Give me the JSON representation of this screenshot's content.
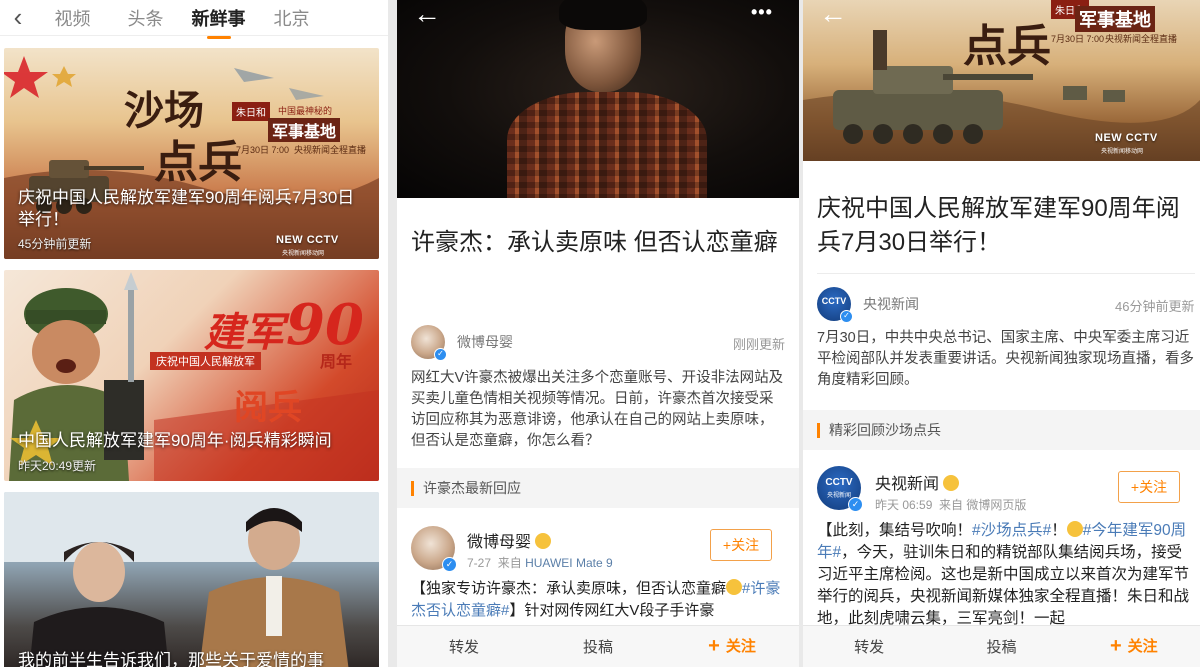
{
  "panel1": {
    "nav": {
      "back_icon": "chevron-left-icon",
      "tabs": [
        {
          "label": "视频",
          "active": false
        },
        {
          "label": "头条",
          "active": false
        },
        {
          "label": "新鲜事",
          "active": true
        },
        {
          "label": "北京",
          "active": false
        }
      ],
      "active_color": "#ff8200"
    },
    "cards": [
      {
        "title": "庆祝中国人民解放军建军90周年阅兵7月30日举行！",
        "time": "45分钟前更新",
        "poster_big_text_1": "沙场",
        "poster_big_text_2": "点兵",
        "poster_person": "朱日和",
        "poster_tag": "中国最神秘的",
        "poster_headline": "军事基地",
        "poster_date": "7月30日 7:00",
        "poster_channel": "央视新闻全程直播",
        "logo": "NEW CCTV",
        "logo_sub": "央视新闻移动网"
      },
      {
        "title": "中国人民解放军建军90周年·阅兵精彩瞬间",
        "time": "昨天20:49更新",
        "poster_line_1": "建军",
        "poster_number": "90",
        "poster_unit": "周年",
        "poster_banner": "庆祝中国人民解放军",
        "poster_line_2": "阅兵"
      },
      {
        "title": "我的前半生告诉我们，那些关于爱情的事"
      }
    ]
  },
  "panel2": {
    "top_icons": {
      "back": "arrow-left-icon",
      "more": "more-dots-icon"
    },
    "title": "许豪杰：承认卖原味 但否认恋童癖",
    "author": {
      "name": "微博母婴",
      "time": "刚刚更新"
    },
    "body": "网红大V许豪杰被爆出关注多个恋童账号、开设非法网站及买卖儿童色情相关视频等情况。日前，许豪杰首次接受采访回应称其为恶意诽谤，他承认在自己的网站上卖原味，但否认是恋童癖，你怎么看？",
    "section_label": "许豪杰最新回应",
    "post": {
      "name": "微博母婴",
      "date": "7-27",
      "source_prefix": "来自",
      "source": "HUAWEI Mate 9",
      "follow_label": "+关注",
      "text_1": "【独家专访许豪杰：承认卖原味，但否认恋童癖",
      "tag": "#许豪杰否认恋童癖#",
      "text_2": "】针对网传网红大V段子手许豪"
    },
    "bottom_bar": {
      "repost": "转发",
      "comment": "投稿",
      "follow": "关注"
    }
  },
  "panel3": {
    "top_icons": {
      "back": "arrow-left-icon"
    },
    "hero": {
      "big_text": "点兵",
      "person": "朱日和",
      "headline": "军事基地",
      "date": "7月30日 7:00",
      "channel": "央视新闻全程直播",
      "logo": "NEW CCTV",
      "logo_sub": "央视新闻移动网"
    },
    "title": "庆祝中国人民解放军建军90周年阅兵7月30日举行！",
    "author": {
      "name": "央视新闻",
      "time": "46分钟前更新",
      "avatar_text": "CCTV"
    },
    "body": "7月30日，中共中央总书记、国家主席、中央军委主席习近平检阅部队并发表重要讲话。央视新闻独家现场直播，看多角度精彩回顾。",
    "section_label": "精彩回顾沙场点兵",
    "post": {
      "name": "央视新闻",
      "date": "昨天 06:59",
      "source_prefix": "来自",
      "source": "微博网页版",
      "follow_label": "+关注",
      "avatar_text": "CCTV",
      "avatar_sub": "央视新闻",
      "text_1": "【此刻，集结号吹响！",
      "tag_1": "#沙场点兵#",
      "text_2": "！",
      "tag_2": "#今年建军90周年#",
      "text_3": "，今天，驻训朱日和的精锐部队集结阅兵场，接受习近平主席检阅。这也是新中国成立以来首次为建军节举行的阅兵，央视新闻新媒体独家全程直播！朱日和战地，此刻虎啸云集，三军亮剑！一起"
    },
    "bottom_bar": {
      "repost": "转发",
      "comment": "投稿",
      "follow": "关注"
    }
  },
  "colors": {
    "accent": "#ff8200",
    "link": "#4a7bb7",
    "verified": "#2d8ef0"
  }
}
